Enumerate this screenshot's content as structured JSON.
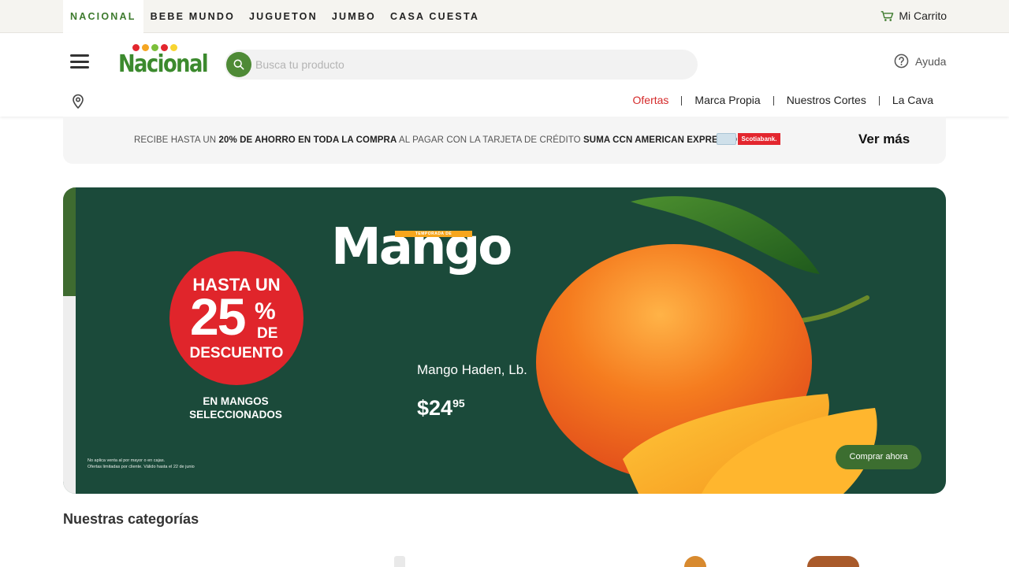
{
  "store_tabs": [
    {
      "label": "NACIONAL",
      "active": true
    },
    {
      "label": "BEBE MUNDO",
      "active": false
    },
    {
      "label": "JUGUETON",
      "active": false
    },
    {
      "label": "JUMBO",
      "active": false
    },
    {
      "label": "CASA CUESTA",
      "active": false
    }
  ],
  "cart": {
    "label": "Mi Carrito",
    "icon": "cart-icon"
  },
  "header": {
    "logo_text": "Nacional",
    "logo_dot_colors": [
      "#e3262e",
      "#f5a623",
      "#7cbf3a",
      "#e3262e",
      "#f8d531"
    ],
    "search_placeholder": "Busca tu producto",
    "help_label": "Ayuda"
  },
  "nav": [
    {
      "label": "Ofertas",
      "highlight": true
    },
    {
      "label": "Marca Propia"
    },
    {
      "label": "Nuestros Cortes"
    },
    {
      "label": "La Cava"
    }
  ],
  "promo": {
    "text_1": "RECIBE HASTA UN ",
    "text_2": "20% DE AHORRO EN TODA LA COMPRA",
    "text_3": " AL PAGAR CON LA TARJETA DE CRÉDITO ",
    "text_4": "SUMA CCN AMERICAN EXPRESS®",
    "bank": "Scotiabank.",
    "link": "Ver más"
  },
  "hero": {
    "badge_line1": "HASTA UN",
    "badge_pct": "25",
    "badge_pct_sign": "%",
    "badge_de": "DE",
    "badge_line3": "DESCUENTO",
    "badge_sub": "EN MANGOS SELECCIONADOS",
    "legal_1": "No aplica venta al por mayor o en cajas.",
    "legal_2": "Ofertas limitadas por cliente. Válido hasta el 22 de junio",
    "season_tag": "TEMPORADA DE",
    "title": "Mango",
    "product_name": "Mango Haden, Lb.",
    "price_main": "$24",
    "price_cents": "95",
    "cta": "Comprar ahora",
    "colors": {
      "bg": "#1b4a3a",
      "badge": "#e0252b",
      "cta": "#3c6e30"
    }
  },
  "categories": {
    "title": "Nuestras categorías"
  }
}
